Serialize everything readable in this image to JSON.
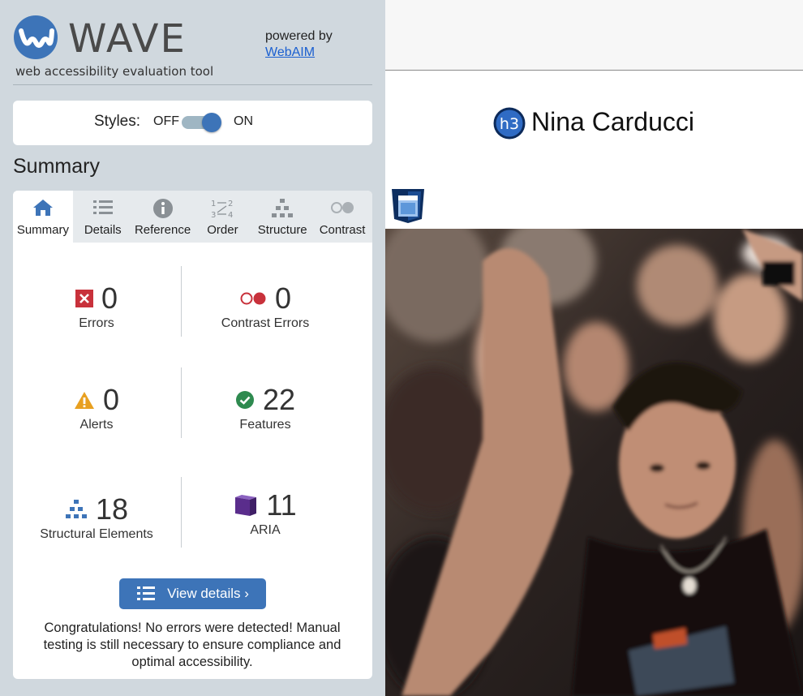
{
  "wave": {
    "logo_text": "WAVE",
    "tagline": "web accessibility evaluation tool",
    "powered_by": "powered by",
    "webaim_link": "WebAIM"
  },
  "styles_toggle": {
    "label": "Styles:",
    "off": "OFF",
    "on": "ON",
    "state": "on"
  },
  "summary_heading": "Summary",
  "tabs": [
    {
      "label": "Summary",
      "icon": "home-icon",
      "active": true
    },
    {
      "label": "Details",
      "icon": "list-icon",
      "active": false
    },
    {
      "label": "Reference",
      "icon": "info-icon",
      "active": false
    },
    {
      "label": "Order",
      "icon": "order-icon",
      "active": false
    },
    {
      "label": "Structure",
      "icon": "structure-icon",
      "active": false
    },
    {
      "label": "Contrast",
      "icon": "contrast-icon",
      "active": false
    }
  ],
  "stats": {
    "errors": {
      "count": "0",
      "label": "Errors",
      "icon": "error-x-icon"
    },
    "contrast_errors": {
      "count": "0",
      "label": "Contrast Errors",
      "icon": "contrast-error-icon"
    },
    "alerts": {
      "count": "0",
      "label": "Alerts",
      "icon": "alert-triangle-icon"
    },
    "features": {
      "count": "22",
      "label": "Features",
      "icon": "feature-check-icon"
    },
    "structural": {
      "count": "18",
      "label": "Structural Elements",
      "icon": "structure-icon"
    },
    "aria": {
      "count": "11",
      "label": "ARIA",
      "icon": "aria-cube-icon"
    }
  },
  "view_details": "View details ›",
  "congrats": "Congratulations! No errors were detected! Manual testing is still necessary to ensure compliance and optimal accessibility.",
  "preview": {
    "h3_badge": "h3",
    "heading": "Nina Carducci",
    "css_icon": "css-icon",
    "photo": "concert-crowd-photo"
  },
  "colors": {
    "wave_blue": "#3d74b8",
    "sidebar_bg": "#d0d8de",
    "error_red": "#c8313b",
    "alert_orange": "#e8a020",
    "feature_green": "#2e8a4f",
    "aria_purple": "#5a2d8c"
  }
}
